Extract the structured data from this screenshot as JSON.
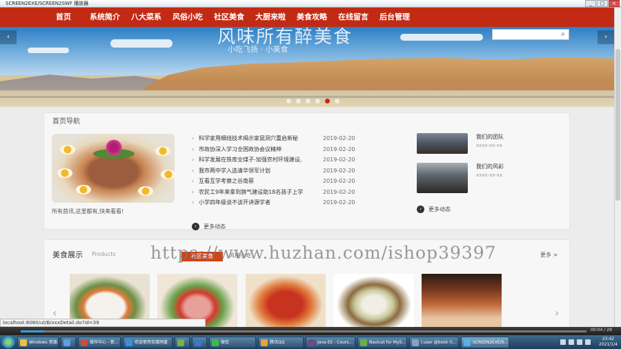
{
  "window": {
    "title": "SCREEN2EXE/SCREEN2SWF 播放器",
    "min": "_",
    "max": "□",
    "close": "×"
  },
  "nav": [
    "首页",
    "系统简介",
    "八大菜系",
    "风俗小吃",
    "社区美食",
    "大厨来啦",
    "美食攻略",
    "在线留言",
    "后台管理"
  ],
  "banner": {
    "overlay_title": "风味所有醉美食",
    "overlay_sub": "小吃飞扬 · 小美食",
    "prev": "‹",
    "next": "›",
    "search_icon_glyph": "⌕"
  },
  "news": {
    "title": "首页导航",
    "caption": "所有首讯,这里都有,快来看看!",
    "items": [
      {
        "text": "科学家用细线技术揭示家鼠洞穴重启新秘",
        "date": "2019-02-20"
      },
      {
        "text": "市政协深入学习全国政协会议精神",
        "date": "2019-02-20"
      },
      {
        "text": "科学发展在铁库全煤子-加强农村环境建设,",
        "date": "2019-02-20"
      },
      {
        "text": "我市两中学入选清华领军计划",
        "date": "2019-02-20"
      },
      {
        "text": "互看互学考察之谷南蔡",
        "date": "2019-02-20"
      },
      {
        "text": "农民工9年来拿到旗气建设助18名孩子上学",
        "date": "2019-02-20"
      },
      {
        "text": "小学四年级谈不该开讲源学者",
        "date": "2019-02-20"
      }
    ],
    "more_left": "更多动态",
    "team": [
      {
        "name": "我们的团队",
        "sub": "xxxx-xx-xx"
      },
      {
        "name": "我们的风彩",
        "sub": "xxxx-xx-xx"
      }
    ],
    "more_right": "更多动态"
  },
  "products": {
    "title": "美食展示",
    "title_en": "Products",
    "tab_active": "社区美食",
    "tab_other": "风俗小吃",
    "more": "更多 >",
    "prev": "‹",
    "next": "›"
  },
  "watermark": "https://www.huzhan.com/ishop39397",
  "statusbar": "localhost:8080/ut/B/xxxDetail.do?id=39",
  "player": {
    "progress_fraction": 0.04,
    "timecode": "00:04 / 28"
  },
  "taskbar": {
    "tasks": [
      {
        "label": "Windows 资源...",
        "color": "#e6c14a"
      },
      {
        "label": "",
        "color": "#5aa0e0"
      },
      {
        "label": "操作中心 - 新...",
        "color": "#d04a3a"
      },
      {
        "label": "欢迎使用百度网盘",
        "color": "#3a8fe0"
      },
      {
        "label": "",
        "color": "#78b04a"
      },
      {
        "label": "",
        "color": "#3c78c8"
      },
      {
        "label": "微信",
        "color": "#3dbb4a"
      },
      {
        "label": "腾讯QQ",
        "color": "#e8a43a"
      },
      {
        "label": "Java EE - Cours...",
        "color": "#6a4a8a"
      },
      {
        "label": "Navicat for MyS...",
        "color": "#6ab04a"
      },
      {
        "label": "l.user @book (l...",
        "color": "#8aa0c0"
      },
      {
        "label": "SCREEN2EXE/S...",
        "color": "#58b0e8"
      }
    ],
    "clock_time": "23:42",
    "clock_date": "2021/1/4"
  }
}
